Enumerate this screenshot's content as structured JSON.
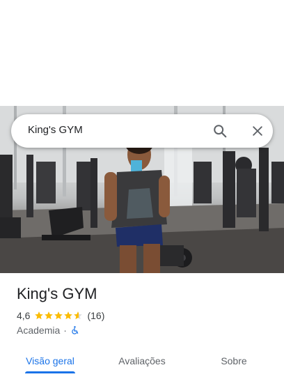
{
  "search": {
    "query": "King's GYM"
  },
  "place": {
    "title": "King's GYM",
    "rating": "4,6",
    "stars": 4.6,
    "review_count": "(16)",
    "category": "Academia",
    "separator": "·"
  },
  "tabs": [
    {
      "label": "Visão geral",
      "active": true
    },
    {
      "label": "Avaliações",
      "active": false
    },
    {
      "label": "Sobre",
      "active": false
    }
  ],
  "colors": {
    "accent": "#1a73e8",
    "star": "#fbbc04",
    "star_empty": "#dadce0"
  },
  "icons": {
    "search": "search-icon",
    "close": "close-icon",
    "accessibility": "wheelchair-icon"
  }
}
